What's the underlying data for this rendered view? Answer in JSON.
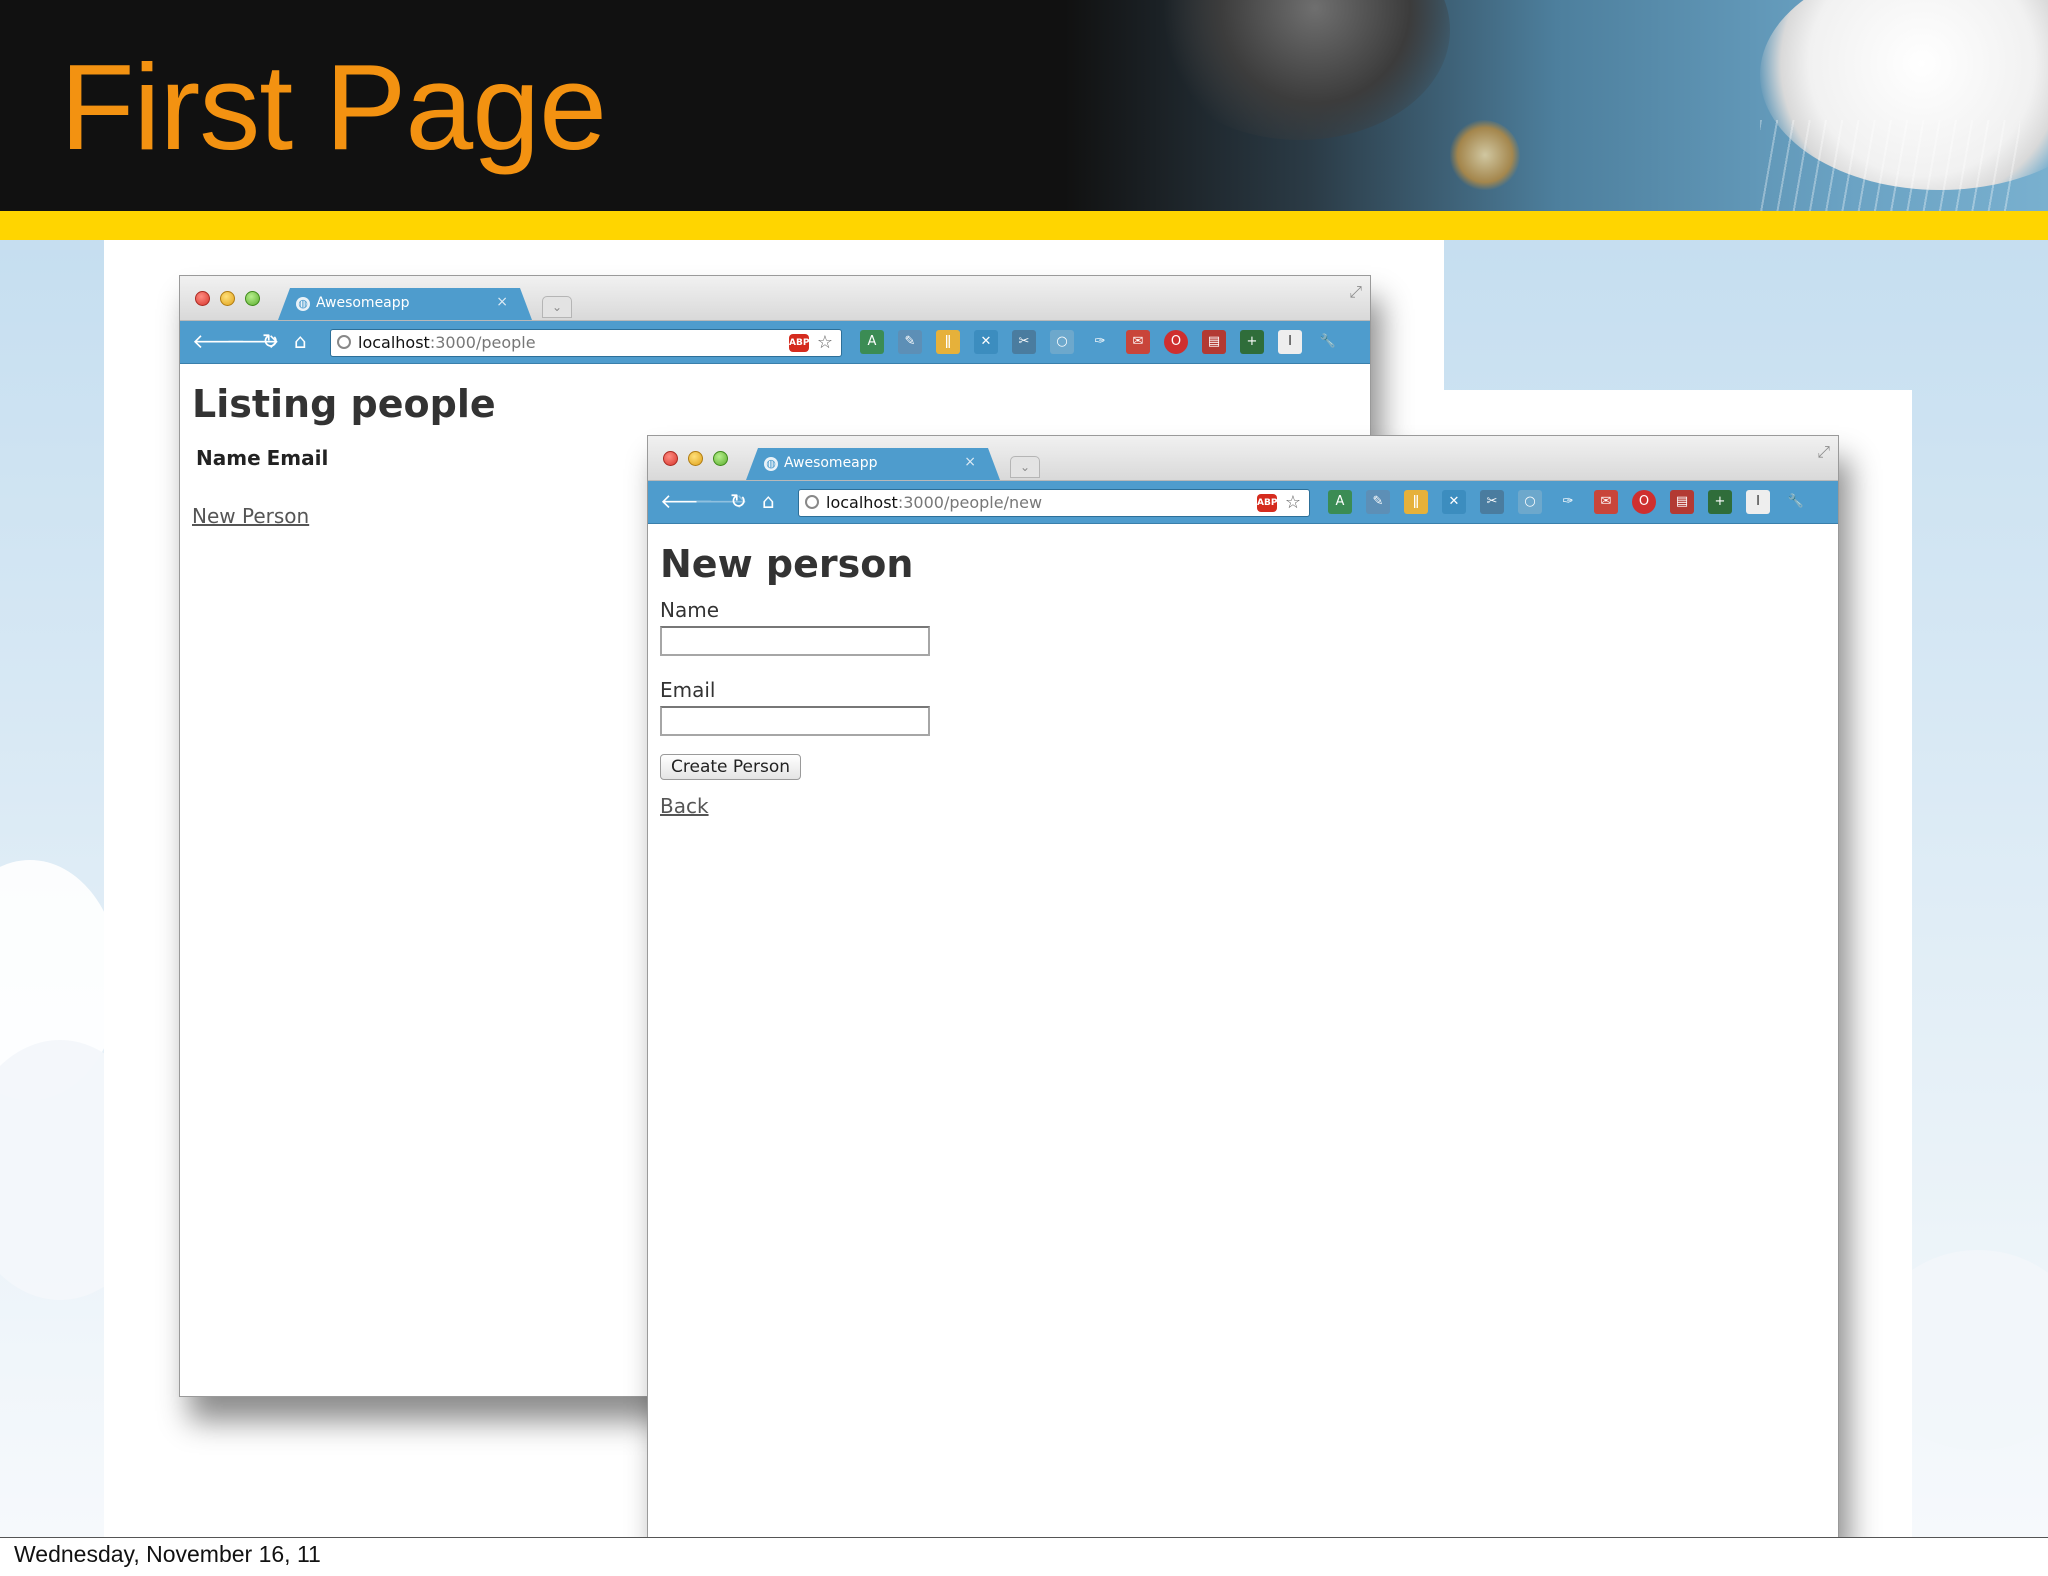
{
  "slide": {
    "title": "First Page",
    "footer_date": "Wednesday, November 16, 11"
  },
  "colors": {
    "title_orange": "#f39211",
    "accent_yellow": "#ffd500",
    "browser_blue": "#4e9ccd"
  },
  "back_window": {
    "tab_title": "Awesomeapp",
    "tab_close": "×",
    "url_host": "localhost",
    "url_path": ":3000/people",
    "page": {
      "heading": "Listing people",
      "columns": [
        "Name",
        "Email"
      ],
      "new_link": "New Person"
    }
  },
  "front_window": {
    "tab_title": "Awesomeapp",
    "tab_close": "×",
    "url_host": "localhost",
    "url_path": ":3000/people/new",
    "page": {
      "heading": "New person",
      "name_label": "Name",
      "name_value": "",
      "email_label": "Email",
      "email_value": "",
      "submit_label": "Create Person",
      "back_link": "Back"
    }
  },
  "toolbar": {
    "nav_icons": [
      "back-arrow-icon",
      "forward-arrow-icon",
      "reload-icon",
      "home-icon"
    ],
    "omnibox_icons": [
      "adblock-icon",
      "bookmark-star-icon"
    ],
    "extension_icons": [
      "translate-icon",
      "pin-icon",
      "fork-knife-icon",
      "x-icon",
      "tools-icon",
      "magnifier-icon",
      "pushpin-icon",
      "gmail-icon",
      "opera-icon",
      "pdf-icon",
      "plus-icon",
      "instapaper-icon",
      "wrench-icon"
    ]
  }
}
